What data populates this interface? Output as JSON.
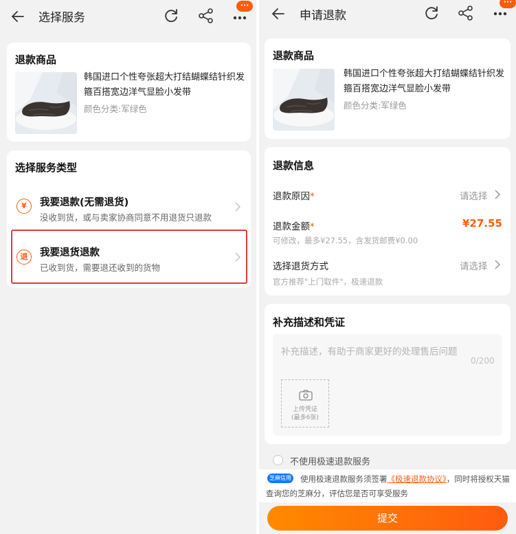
{
  "left": {
    "header": {
      "title": "选择服务",
      "badge": "···"
    },
    "product": {
      "section_title": "退款商品",
      "name": "韩国进口个性夸张超大打结蝴蝶结针织发箍百搭宽边洋气显脸小发带",
      "sku": "颜色分类:军绿色"
    },
    "service": {
      "section_title": "选择服务类型",
      "options": [
        {
          "icon": "refund-yuan-icon",
          "icon_text": "¥",
          "title": "我要退款(无需退货)",
          "desc": "没收到货，或与卖家协商同意不用退货只退款"
        },
        {
          "icon": "return-refund-icon",
          "icon_text": "退",
          "title": "我要退货退款",
          "desc": "已收到货，需要退还收到的货物"
        }
      ]
    }
  },
  "right": {
    "header": {
      "title": "申请退款",
      "badge": "···"
    },
    "product": {
      "section_title": "退款商品",
      "name": "韩国进口个性夸张超大打结蝴蝶结针织发箍百搭宽边洋气显脸小发带",
      "sku": "颜色分类:军绿色"
    },
    "refund_info": {
      "section_title": "退款信息",
      "reason_label": "退款原因",
      "reason_value": "请选择",
      "amount_label": "退款金额",
      "amount_value": "¥27.55",
      "amount_note": "可修改，最多¥27.55，含发货邮费¥0.00",
      "method_label": "选择退货方式",
      "method_value": "请选择",
      "method_note": "官方推荐\"上门取件\"，极速退款",
      "required_mark": "*"
    },
    "description": {
      "section_title": "补充描述和凭证",
      "placeholder": "补充描述，有助于商家更好的处理售后问题",
      "counter": "0/200",
      "upload_line1": "上传凭证",
      "upload_line2": "(最多6张)"
    },
    "fast_refund": {
      "label": "不使用极速退款服务"
    },
    "notice": {
      "badge": "芝麻信用",
      "text_before": "使用极速退款服务须签署",
      "link": "《极速退款协议》",
      "text_after": "，同时将授权天猫查询您的芝麻分，评估您是否可享受服务"
    },
    "submit_label": "提交"
  },
  "colors": {
    "accent": "#ff5b0e",
    "highlight": "#e53935",
    "background": "#f2f2f2",
    "zhima_blue": "#1677ff"
  }
}
